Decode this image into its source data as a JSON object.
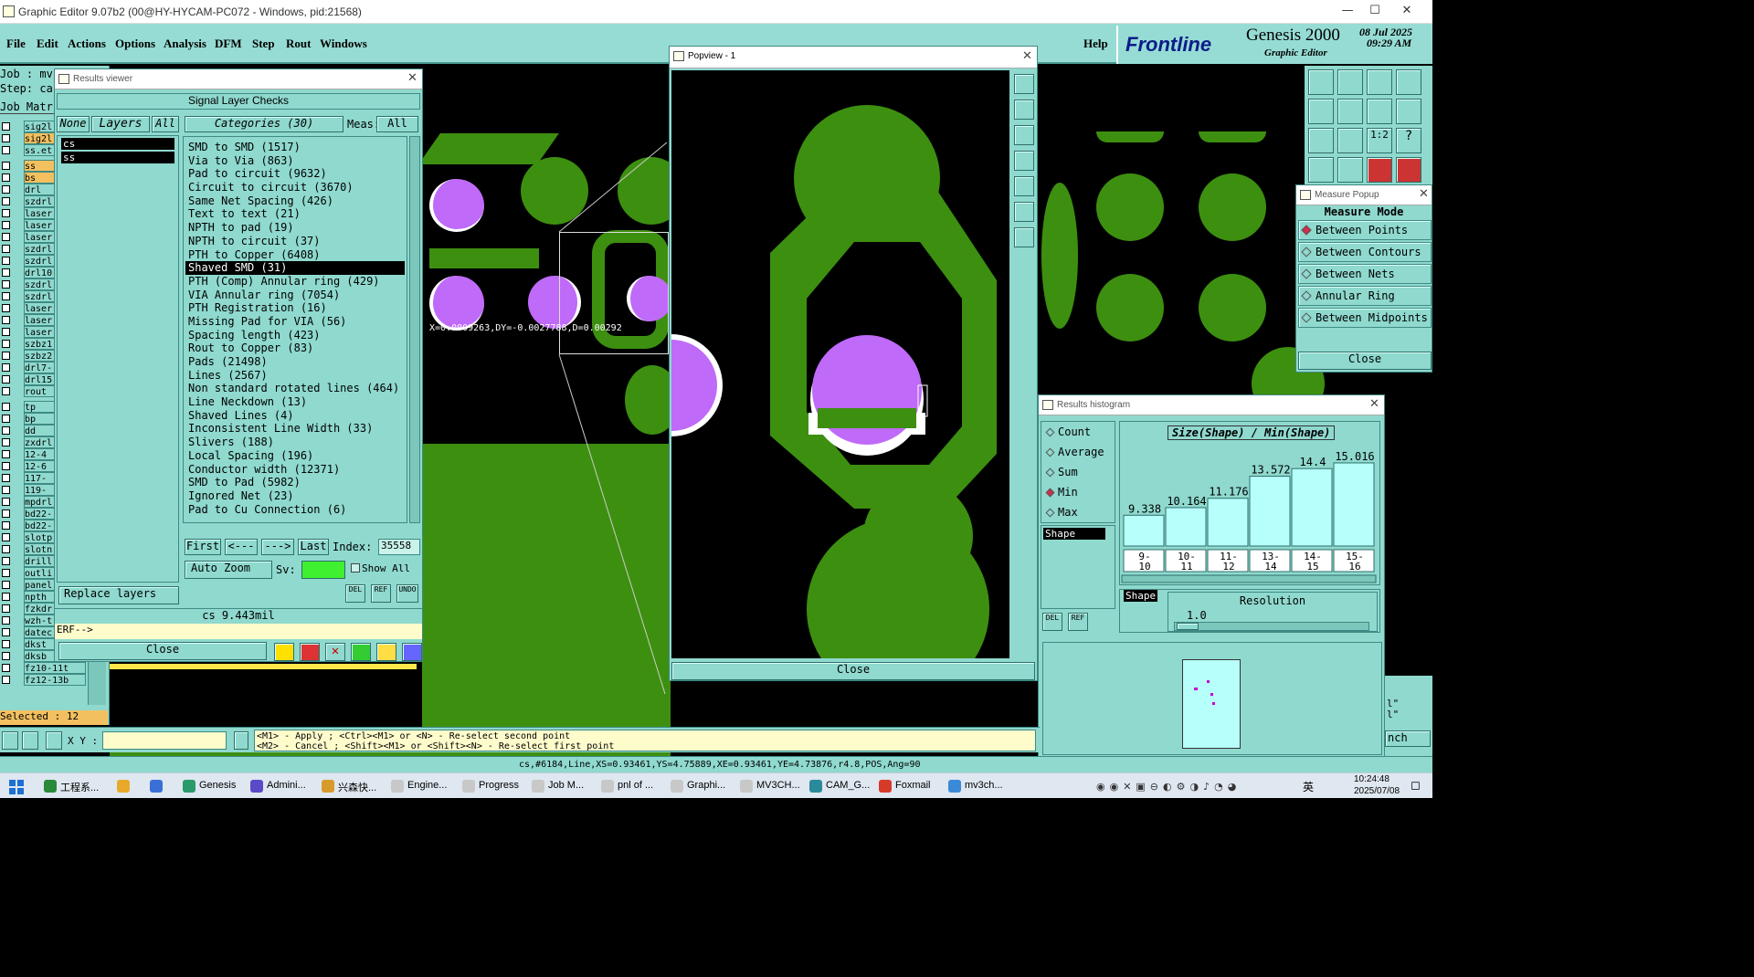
{
  "window": {
    "title": "Graphic Editor 9.07b2 (00@HY-HYCAM-PC072 - Windows, pid:21568)",
    "minimize": "—",
    "maximize": "☐",
    "close": "✕"
  },
  "menu": {
    "items": [
      "File",
      "Edit",
      "Actions",
      "Options",
      "Analysis",
      "DFM",
      "Step",
      "Rout",
      "Windows"
    ],
    "help": "Help"
  },
  "brand": {
    "logo": "Frontline",
    "product": "Genesis 2000",
    "subtitle": "Graphic Editor",
    "date": "08 Jul 2025",
    "time": "09:29 AM"
  },
  "left_panel": {
    "job_label": "Job : mv",
    "step_label": "Step: ca",
    "matrix_label": "Job Matr",
    "layers": [
      "sig2l",
      "sig2l",
      "ss.et",
      "ss",
      "bs",
      "drl",
      "szdrl",
      "laser",
      "laser",
      "laser",
      "szdrl",
      "szdrl",
      "drl10",
      "szdrl",
      "szdrl",
      "laser",
      "laser",
      "laser",
      "szbz1",
      "szbz2",
      "drl7-",
      "drl15",
      "rout",
      "tp",
      "bp",
      "dd",
      "zxdrl",
      "12-4",
      "12-6",
      "117-",
      "119-",
      "mpdrl",
      "bd22-",
      "bd22-",
      "slotp",
      "slotn",
      "drill",
      "outli",
      "panel",
      "npth",
      "fzkdr",
      "wzh-t",
      "datec",
      "dkst",
      "dksb",
      "fz10-11t",
      "fz12-13b"
    ],
    "selected": "Selected : 12"
  },
  "results_viewer": {
    "title": "Results viewer",
    "header": "Signal Layer Checks",
    "none_btn": "None",
    "layers_btn": "Layers",
    "all_btn": "All",
    "layer_list": [
      "cs",
      "ss"
    ],
    "categories_label": "Categories (30)",
    "meas_label": "Meas:",
    "meas_value": "All",
    "categories": [
      "SMD to SMD (1517)",
      "Via to Via (863)",
      "Pad to circuit (9632)",
      "Circuit to circuit (3670)",
      "Same Net Spacing (426)",
      "Text to text (21)",
      "NPTH to pad (19)",
      "NPTH to circuit (37)",
      "PTH to Copper (6408)",
      "Shaved SMD (31)",
      "PTH (Comp) Annular ring (429)",
      "VIA Annular ring (7054)",
      "PTH Registration (16)",
      "Missing Pad for VIA (56)",
      "Spacing length (423)",
      "Rout to Copper (83)",
      "Pads (21498)",
      "Lines (2567)",
      "Non standard rotated lines (464)",
      "Line Neckdown (13)",
      "Shaved Lines (4)",
      "Inconsistent Line Width (33)",
      "Slivers (188)",
      "Local Spacing (196)",
      "Conductor width (12371)",
      "SMD to Pad (5982)",
      "Ignored Net (23)",
      "Pad to Cu Connection (6)"
    ],
    "selected_index": 9,
    "first_btn": "First",
    "prev_btn": "<---",
    "next_btn": "--->",
    "last_btn": "Last",
    "index_label": "Index:",
    "index_value": "35558",
    "autozoom_btn": "Auto Zoom",
    "sv_label": "Sv:",
    "show_all": "Show All",
    "replace_btn": "Replace layers",
    "status": "cs 9.443mil",
    "erf": "ERF-->",
    "close_btn": "Close",
    "del_btn": "DEL",
    "ref_btn": "REF",
    "undo_btn": "UNDO"
  },
  "canvas": {
    "measure_text": "X=0.0009263,DY=-0.0027788,D=0.00292"
  },
  "popview": {
    "title": "Popview - 1",
    "close_btn": "Close"
  },
  "measure_popup": {
    "title": "Measure Popup",
    "mode_header": "Measure Mode",
    "modes": [
      "Between Points",
      "Between Contours",
      "Between Nets",
      "Annular Ring",
      "Between Midpoints"
    ],
    "selected_mode": 0,
    "close_btn": "Close"
  },
  "histogram": {
    "title": "Results histogram",
    "options": [
      "Count",
      "Average",
      "Sum",
      "Min",
      "Max"
    ],
    "selected_option": 3,
    "chart_title": "Size(Shape) / Min(Shape)",
    "shape_list": [
      "Shape"
    ],
    "shape_label": "Shape",
    "resolution_label": "Resolution",
    "resolution_value": "1.0",
    "del_btn": "DEL",
    "ref_btn": "REF"
  },
  "chart_data": {
    "type": "bar",
    "title": "Size(Shape) / Min(Shape)",
    "categories": [
      "9-10",
      "10-11",
      "11-12",
      "13-14",
      "14-15",
      "15-16"
    ],
    "values": [
      9.338,
      10.164,
      11.176,
      13.572,
      14.4,
      15.016
    ],
    "value_labels": [
      "9.338",
      "10.164",
      "11.176",
      "13.572",
      "14.4",
      "15.016"
    ],
    "ylim": [
      0,
      16.5
    ],
    "bar_color": "#b6fffb"
  },
  "right_strip": {
    "lines": [
      "l\"",
      "l\"",
      "nch"
    ]
  },
  "bottom": {
    "xy_label": "X Y :",
    "xy_value": "",
    "hint1": "<M1> - Apply  ; <Ctrl><M1> or <N> - Re-select second point",
    "hint2": "<M2> - Cancel ; <Shift><M1> or <Shift><N> - Re-select first point",
    "status": "cs,#6184,Line,XS=0.93461,YS=4.75889,XE=0.93461,YE=4.73876,r4.8,POS,Ang=90"
  },
  "taskbar": {
    "items": [
      "工程系...",
      "",
      "",
      "Genesis",
      "Admini...",
      "兴森快...",
      "Engine...",
      "Progress",
      "Job M...",
      "pnl of ...",
      "Graphi...",
      "MV3CH...",
      "CAM_G...",
      "Foxmail",
      "mv3ch..."
    ],
    "time": "10:24:48",
    "date": "2025/07/08",
    "ime": "英"
  }
}
